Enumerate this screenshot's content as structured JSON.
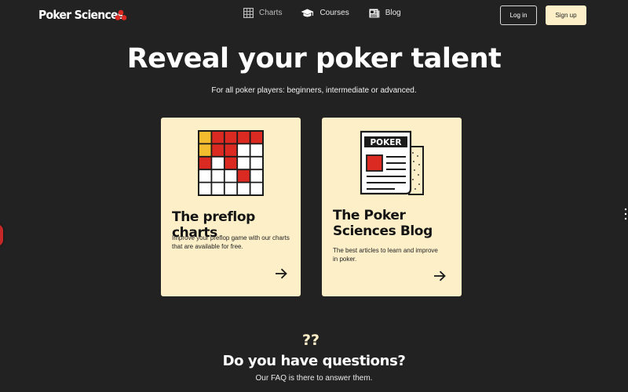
{
  "header": {
    "logo_text": "Poker Sciences",
    "logo_icon": "three-dots-logo-icon",
    "nav": {
      "charts": {
        "label": "Charts",
        "icon": "grid-icon"
      },
      "courses": {
        "label": "Courses",
        "icon": "graduation-cap-icon"
      },
      "blog": {
        "label": "Blog",
        "icon": "newspaper-icon"
      }
    },
    "login_label": "Log in",
    "signup_label": "Sign up"
  },
  "hero": {
    "title": "Reveal your poker talent",
    "subtitle": "For all poker players: beginners, intermediate or advanced."
  },
  "cards": [
    {
      "title": "The preflop charts",
      "description": "Improve your preflop game with our charts that are available for free.",
      "icon": "preflop-grid-illustration"
    },
    {
      "title": "The Poker\nSciences Blog",
      "description": "The best articles to learn and improve in poker.",
      "newspaper_heading": "POKER",
      "icon": "newspaper-illustration"
    }
  ],
  "faq": {
    "icon_text": "??",
    "title": "Do you have questions?",
    "subtitle": "Our FAQ is there to answer them."
  },
  "colors": {
    "background": "#232222",
    "card": "#fdf0c9",
    "accent_red": "#db2a22",
    "accent_yellow": "#f2bc2e",
    "button_light": "#fdf0c9"
  }
}
